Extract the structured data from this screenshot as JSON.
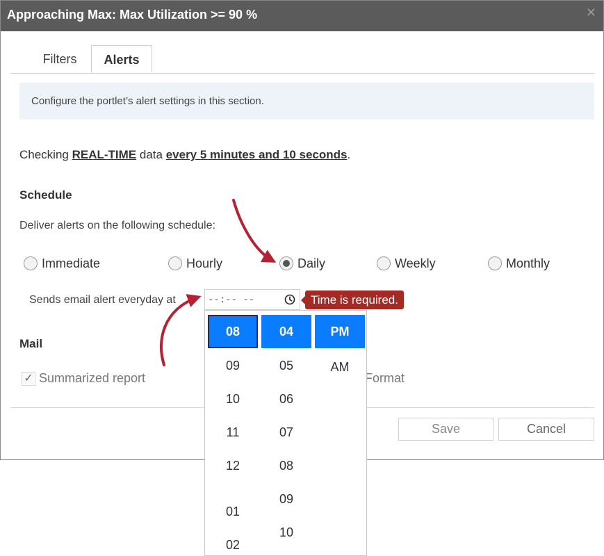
{
  "dialog": {
    "title": "Approaching Max: Max Utilization >= 90 %",
    "close_icon": "close-icon"
  },
  "tabs": [
    {
      "label": "Filters",
      "active": false
    },
    {
      "label": "Alerts",
      "active": true
    }
  ],
  "info": "Configure the portlet’s alert settings in this section.",
  "checking": {
    "prefix": "Checking ",
    "data_type": "REAL-TIME",
    "middle": " data ",
    "interval": "every 5 minutes and 10 seconds",
    "suffix": "."
  },
  "schedule": {
    "heading": "Schedule",
    "deliver_label": "Deliver alerts on the following schedule:",
    "options": [
      {
        "label": "Immediate",
        "checked": false
      },
      {
        "label": "Hourly",
        "checked": false
      },
      {
        "label": "Daily",
        "checked": true
      },
      {
        "label": "Weekly",
        "checked": false
      },
      {
        "label": "Monthly",
        "checked": false
      }
    ],
    "sends_label": "Sends email alert everyday at",
    "time_value": "--:-- --",
    "error": "Time is required."
  },
  "mail": {
    "heading": "Mail",
    "summarized_label": "Summarized report",
    "summarized_checked": true,
    "format_label": "Format"
  },
  "buttons": {
    "save": "Save",
    "cancel": "Cancel"
  },
  "picker": {
    "hours": [
      "08",
      "09",
      "10",
      "11",
      "12",
      "01",
      "02"
    ],
    "minutes": [
      "04",
      "05",
      "06",
      "07",
      "08",
      "09",
      "10"
    ],
    "periods": [
      "PM",
      "AM"
    ],
    "selected_hour": "08",
    "selected_minute": "04",
    "selected_period": "PM"
  },
  "colors": {
    "accent": "#0a7cff",
    "error": "#a52a24",
    "annotation_arrow": "#b52235",
    "titlebar": "#5b5b5b"
  }
}
